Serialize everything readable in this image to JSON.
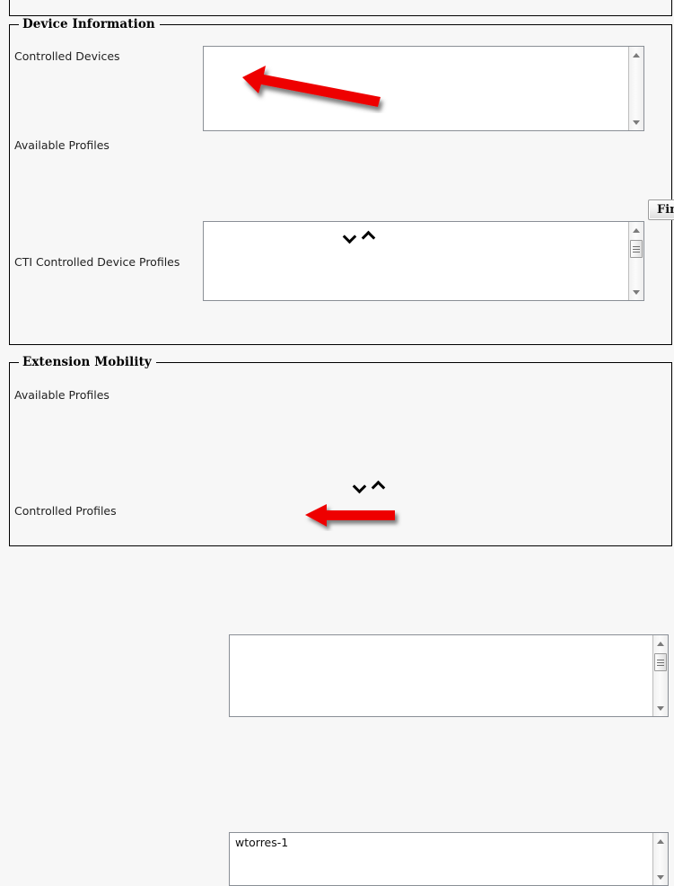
{
  "page": {
    "background_color": "#f7f7f7",
    "accent_annotation_color": "#ee0000",
    "listbox_border_color": "#8a8f96"
  },
  "sections": [
    {
      "legend": "Device Information",
      "fields": [
        {
          "label": "Controlled Devices",
          "control": "listbox",
          "options": [],
          "scrollbar": {
            "visible": true,
            "thumb": false
          }
        },
        {
          "label": "Available Profiles",
          "control": "listbox",
          "options": [],
          "scrollbar": {
            "visible": true,
            "thumb": true
          }
        },
        {
          "label": "CTI Controlled Device Profiles",
          "control": "listbox",
          "options": [],
          "scrollbar": {
            "visible": true,
            "thumb": false
          }
        }
      ],
      "transfer_controls": {
        "down": "chevron-down",
        "up": "chevron-up"
      },
      "buttons": [
        {
          "label": "Find",
          "clipped": true
        }
      ]
    },
    {
      "legend": "Extension Mobility",
      "fields": [
        {
          "label": "Available Profiles",
          "control": "listbox",
          "options": [],
          "scrollbar": {
            "visible": true,
            "thumb": true
          }
        },
        {
          "label": "Controlled Profiles",
          "control": "listbox",
          "options": [
            "wtorres-1"
          ],
          "scrollbar": {
            "visible": true,
            "thumb": false
          }
        }
      ],
      "transfer_controls": {
        "down": "chevron-down",
        "up": "chevron-up"
      }
    }
  ],
  "annotations": [
    {
      "name": "arrow-to-controlled-devices",
      "shape": "left-arrow",
      "color": "#ee0000"
    },
    {
      "name": "arrow-to-controlled-profiles",
      "shape": "left-arrow",
      "color": "#ee0000"
    }
  ]
}
